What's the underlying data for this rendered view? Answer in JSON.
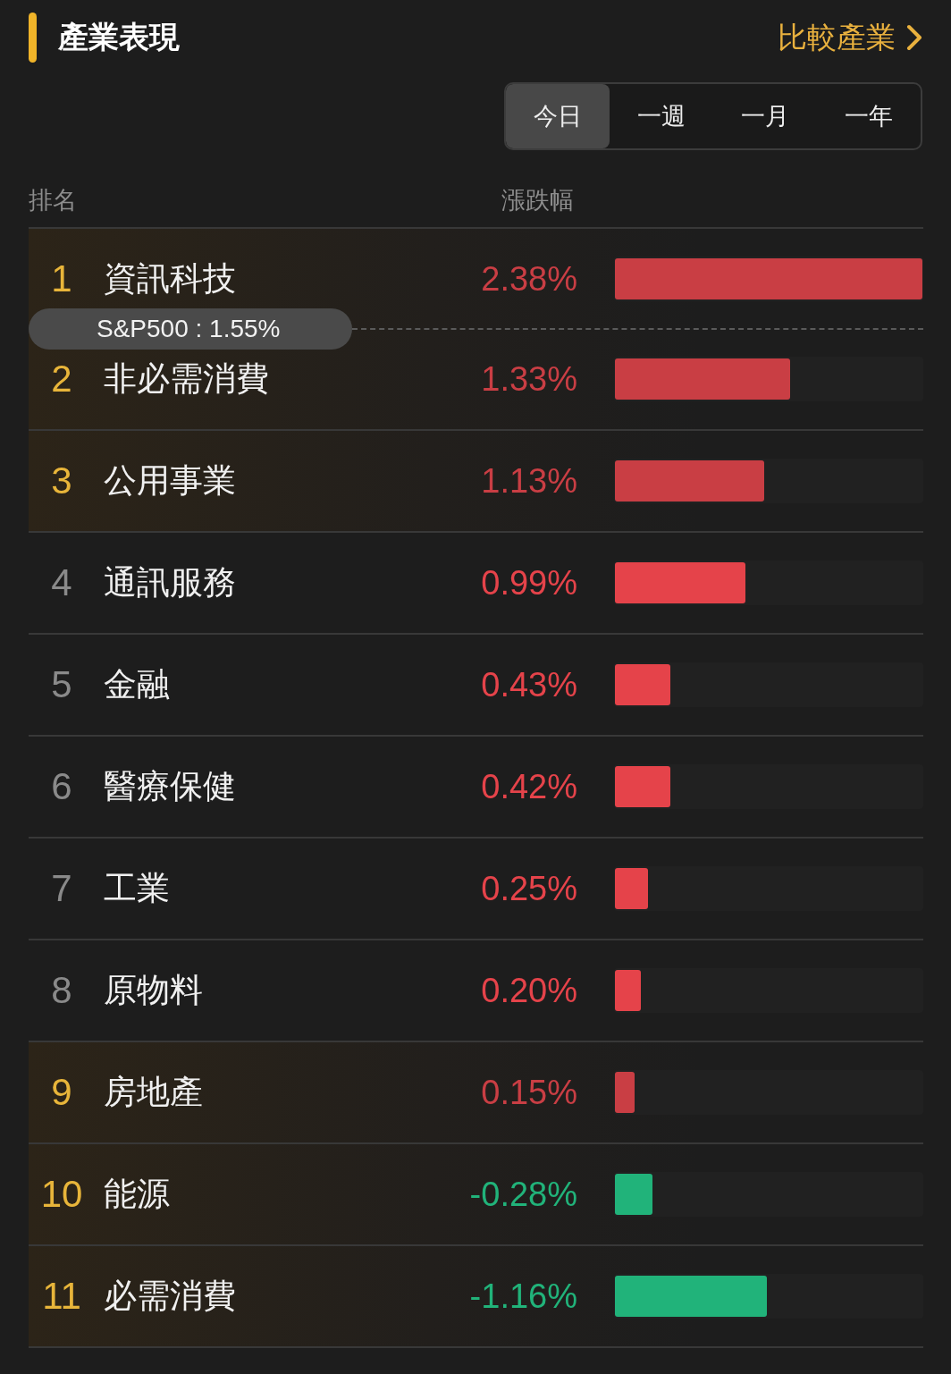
{
  "header": {
    "title": "產業表現",
    "link": "比較產業"
  },
  "periods": [
    {
      "label": "今日",
      "selected": true
    },
    {
      "label": "一週",
      "selected": false
    },
    {
      "label": "一月",
      "selected": false
    },
    {
      "label": "一年",
      "selected": false
    }
  ],
  "columns": [
    "排名",
    "漲跌幅"
  ],
  "rows": [
    {
      "kind": "sector",
      "rank": "1",
      "name": "資訊科技",
      "change": "2.38%",
      "color": "#c93e44",
      "highlighted": true,
      "level": 1
    },
    {
      "kind": "benchmark",
      "label": "S&P500 : 1.55%"
    },
    {
      "kind": "sector",
      "rank": "2",
      "name": "非必需消費",
      "change": "1.33%",
      "color": "#c93e44",
      "highlighted": true,
      "level": 0.57
    },
    {
      "kind": "sector",
      "rank": "3",
      "name": "公用事業",
      "change": "1.13%",
      "color": "#c93e44",
      "highlighted": true,
      "level": 0.485
    },
    {
      "kind": "sector",
      "rank": "4",
      "name": "通訊服務",
      "change": "0.99%",
      "color": "#e5434a",
      "highlighted": false,
      "level": 0.425
    },
    {
      "kind": "sector",
      "rank": "5",
      "name": "金融",
      "change": "0.43%",
      "color": "#e5434a",
      "highlighted": false,
      "level": 0.18
    },
    {
      "kind": "sector",
      "rank": "6",
      "name": "醫療保健",
      "change": "0.42%",
      "color": "#e5434a",
      "highlighted": false,
      "level": 0.18
    },
    {
      "kind": "sector",
      "rank": "7",
      "name": "工業",
      "change": "0.25%",
      "color": "#e5434a",
      "highlighted": false,
      "level": 0.107
    },
    {
      "kind": "sector",
      "rank": "8",
      "name": "原物料",
      "change": "0.20%",
      "color": "#e5434a",
      "highlighted": false,
      "level": 0.084
    },
    {
      "kind": "sector",
      "rank": "9",
      "name": "房地產",
      "change": "0.15%",
      "color": "#c93e44",
      "highlighted": true,
      "level": 0.064
    },
    {
      "kind": "sector",
      "rank": "10",
      "name": "能源",
      "change": "-0.28%",
      "color": "#21b37a",
      "highlighted": true,
      "level": 0.122
    },
    {
      "kind": "sector",
      "rank": "11",
      "name": "必需消費",
      "change": "-1.16%",
      "color": "#21b37a",
      "highlighted": true,
      "level": 0.494
    }
  ]
}
